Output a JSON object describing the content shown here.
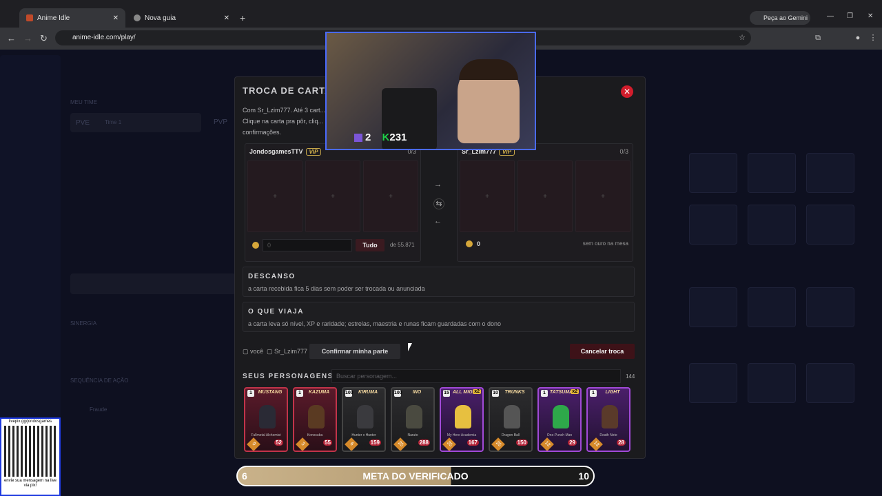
{
  "browser": {
    "tabs": [
      {
        "label": "Anime Idle"
      },
      {
        "label": "Nova guia"
      }
    ],
    "url": "anime-idle.com/play/",
    "gemini_label": "Peça ao Gemini"
  },
  "modal": {
    "title": "TROCA DE CARTAS",
    "desc": "Com Sr_Lzim777. Até 3 cart... Clique na carta pra pôr, cliq... confirmações.",
    "left_panel": {
      "name": "JondosgamesTTV",
      "vip": "VIP",
      "count": "0/3",
      "gold_placeholder": "0",
      "tudo": "Tudo",
      "of_total": "de 55.871"
    },
    "right_panel": {
      "name": "Sr_Lzim777",
      "vip": "VIP",
      "count": "0/3",
      "gold": "0",
      "no_gold": "sem ouro na mesa"
    },
    "slot_plus": "+",
    "arrows": {
      "right": "→",
      "swap": "⇆",
      "left": "←"
    },
    "descanso": {
      "title": "DESCANSO",
      "text": "a carta recebida fica 5 dias sem poder ser trocada ou anunciada"
    },
    "que_viaja": {
      "title": "O QUE VIAJA",
      "text": "a carta leva só nível, XP e raridade; estrelas, maestria e runas ficam guardadas com o dono"
    },
    "check_you": "▢ você",
    "check_other": "▢ Sr_Lzim777",
    "confirm": "Confirmar minha parte",
    "cancel": "Cancelar troca",
    "seus": "SEUS PERSONAGENS",
    "search_placeholder": "Buscar personagem...",
    "char_count": "144"
  },
  "cards": [
    {
      "lvl": "1",
      "name": "MUSTANG",
      "anime": "Fullmetal Alchemist",
      "s1": "9",
      "s2": "52",
      "style": "red",
      "x2": ""
    },
    {
      "lvl": "1",
      "name": "KAZUMA",
      "anime": "Konosuba",
      "s1": "3",
      "s2": "55",
      "style": "red",
      "x2": ""
    },
    {
      "lvl": "100",
      "name": "KIRUMA",
      "anime": "Hunter x Hunter",
      "s1": "6",
      "s2": "159",
      "style": "gray",
      "x2": ""
    },
    {
      "lvl": "100",
      "name": "INO",
      "anime": "Naruto",
      "s1": "25",
      "s2": "288",
      "style": "gray",
      "x2": ""
    },
    {
      "lvl": "15",
      "name": "ALL MIGHT",
      "anime": "My Hero Academia",
      "s1": "35",
      "s2": "167",
      "style": "purple",
      "x2": "x2"
    },
    {
      "lvl": "10",
      "name": "TRUNKS",
      "anime": "Dragon Ball",
      "s1": "25",
      "s2": "150",
      "style": "gray",
      "x2": ""
    },
    {
      "lvl": "1",
      "name": "TATSUMAKI",
      "anime": "One-Punch Man",
      "s1": "13",
      "s2": "29",
      "style": "purple",
      "x2": "x2"
    },
    {
      "lvl": "1",
      "name": "LIGHT",
      "anime": "Death Note",
      "s1": "13",
      "s2": "28",
      "style": "purple",
      "x2": ""
    }
  ],
  "stream": {
    "hud_left": "2",
    "hud_right": "231",
    "meta_left": "6",
    "meta_title": "META DO VERIFICADO",
    "meta_right": "10",
    "meta_progress": 0.6,
    "qr_top": "livepix.gg/jondosgames",
    "qr_bottom": "envie sua mensagem na live via pix!"
  },
  "background": {
    "title": "MEU TIME",
    "mode": "PVE",
    "team": "Time 1",
    "sinergia": "SINERGIA",
    "sequencia": "SEQUÊNCIA DE AÇÃO",
    "pvp": "PVP",
    "char_label": "Fraude"
  }
}
